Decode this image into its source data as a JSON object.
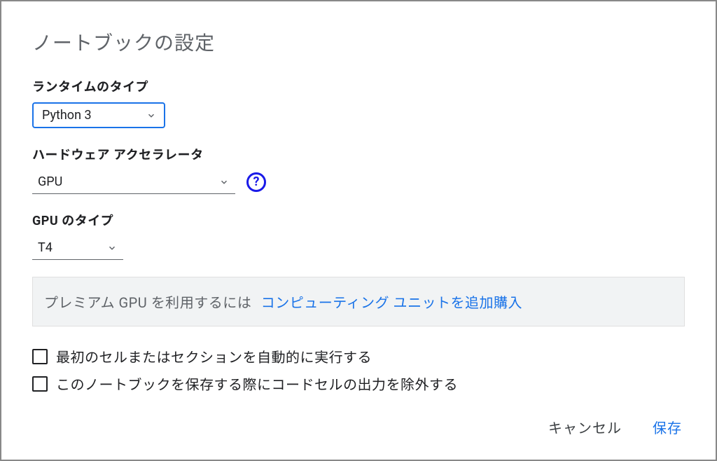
{
  "dialog": {
    "title": "ノートブックの設定"
  },
  "runtime": {
    "label": "ランタイムのタイプ",
    "value": "Python 3"
  },
  "accelerator": {
    "label": "ハードウェア アクセラレータ",
    "value": "GPU"
  },
  "gpu": {
    "label": "GPU のタイプ",
    "value": "T4"
  },
  "banner": {
    "text": "プレミアム GPU を利用するには",
    "link": "コンピューティング ユニットを追加購入"
  },
  "checkboxes": {
    "autorun": "最初のセルまたはセクションを自動的に実行する",
    "omit_output": "このノートブックを保存する際にコードセルの出力を除外する"
  },
  "actions": {
    "cancel": "キャンセル",
    "save": "保存"
  },
  "help_glyph": "?"
}
